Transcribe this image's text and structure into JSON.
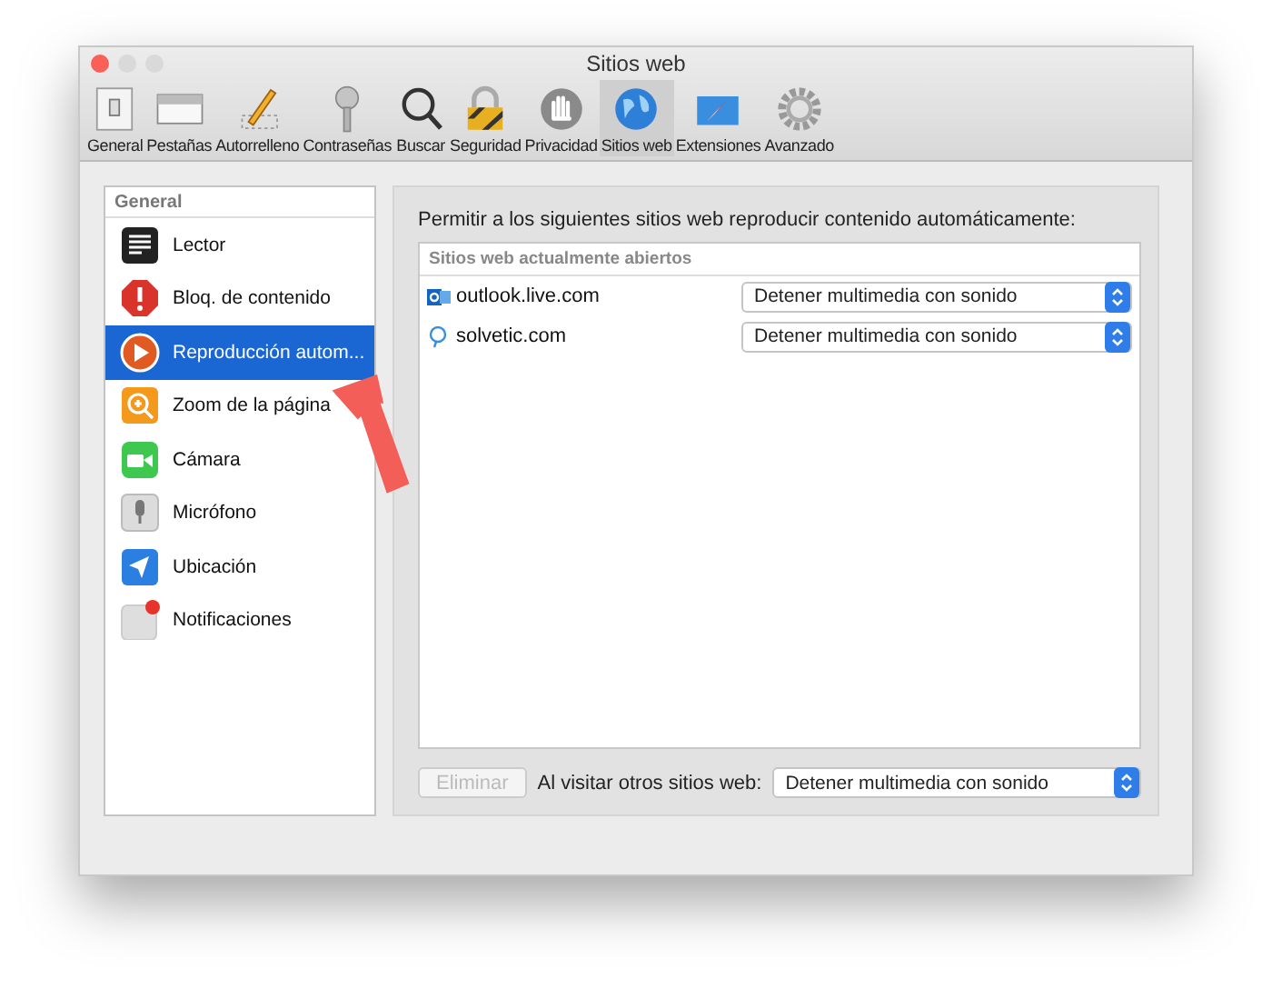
{
  "window": {
    "title": "Sitios web"
  },
  "toolbar": [
    {
      "label": "General",
      "selected": false
    },
    {
      "label": "Pestañas",
      "selected": false
    },
    {
      "label": "Autorrelleno",
      "selected": false
    },
    {
      "label": "Contraseñas",
      "selected": false
    },
    {
      "label": "Buscar",
      "selected": false
    },
    {
      "label": "Seguridad",
      "selected": false
    },
    {
      "label": "Privacidad",
      "selected": false
    },
    {
      "label": "Sitios web",
      "selected": true
    },
    {
      "label": "Extensiones",
      "selected": false
    },
    {
      "label": "Avanzado",
      "selected": false
    }
  ],
  "sidebar": {
    "header": "General",
    "items": [
      {
        "label": "Lector",
        "selected": false
      },
      {
        "label": "Bloq. de contenido",
        "selected": false
      },
      {
        "label": "Reproducción autom...",
        "selected": true
      },
      {
        "label": "Zoom de la página",
        "selected": false
      },
      {
        "label": "Cámara",
        "selected": false
      },
      {
        "label": "Micrófono",
        "selected": false
      },
      {
        "label": "Ubicación",
        "selected": false
      },
      {
        "label": "Notificaciones",
        "selected": false
      }
    ]
  },
  "content": {
    "description": "Permitir a los siguientes sitios web reproducir contenido automáticamente:",
    "table_header": "Sitios web actualmente abiertos",
    "sites": [
      {
        "name": "outlook.live.com",
        "setting": "Detener multimedia con sonido"
      },
      {
        "name": "solvetic.com",
        "setting": "Detener multimedia con sonido"
      }
    ],
    "remove_button": {
      "label": "Eliminar",
      "disabled": true
    },
    "other_sites_label": "Al visitar otros sitios web:",
    "other_sites_setting": "Detener multimedia con sonido"
  }
}
